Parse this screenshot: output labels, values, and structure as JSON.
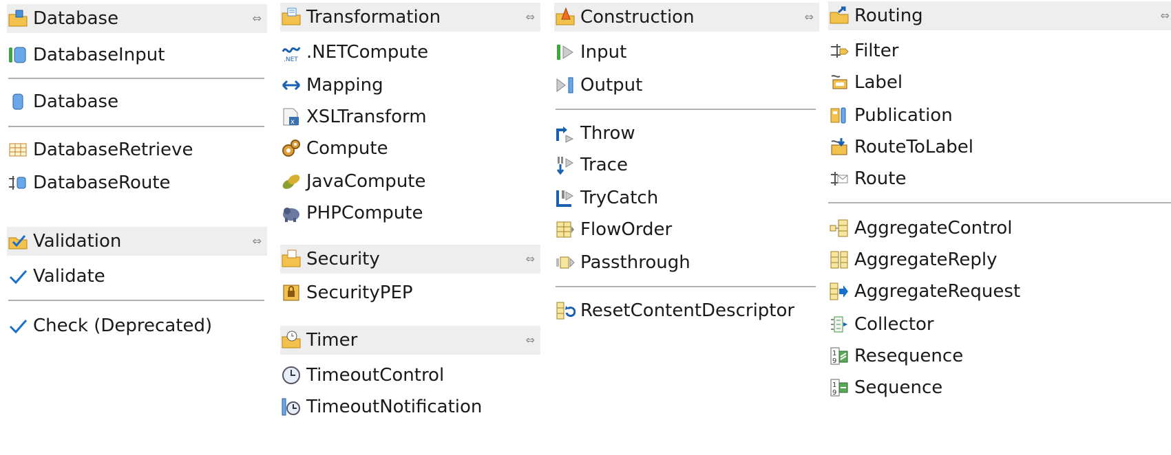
{
  "collapse_glyph": "⇔",
  "database": {
    "drawer": "Database",
    "items": [
      "DatabaseInput",
      "Database",
      "DatabaseRetrieve",
      "DatabaseRoute"
    ]
  },
  "validation": {
    "drawer": "Validation",
    "items": [
      "Validate",
      "Check (Deprecated)"
    ]
  },
  "transformation": {
    "drawer": "Transformation",
    "items": [
      ".NETCompute",
      "Mapping",
      "XSLTransform",
      "Compute",
      "JavaCompute",
      "PHPCompute"
    ]
  },
  "security": {
    "drawer": "Security",
    "items": [
      "SecurityPEP"
    ]
  },
  "timer": {
    "drawer": "Timer",
    "items": [
      "TimeoutControl",
      "TimeoutNotification"
    ]
  },
  "construction": {
    "drawer": "Construction",
    "items": [
      "Input",
      "Output",
      "Throw",
      "Trace",
      "TryCatch",
      "FlowOrder",
      "Passthrough",
      "ResetContentDescriptor"
    ]
  },
  "routing": {
    "drawer": "Routing",
    "items": [
      "Filter",
      "Label",
      "Publication",
      "RouteToLabel",
      "Route",
      "AggregateControl",
      "AggregateReply",
      "AggregateRequest",
      "Collector",
      "Resequence",
      "Sequence"
    ]
  },
  "colors": {
    "drawer_bg": "#eeeeee",
    "check_blue": "#1a6fc9",
    "folder_yellow": "#f2c14e"
  }
}
